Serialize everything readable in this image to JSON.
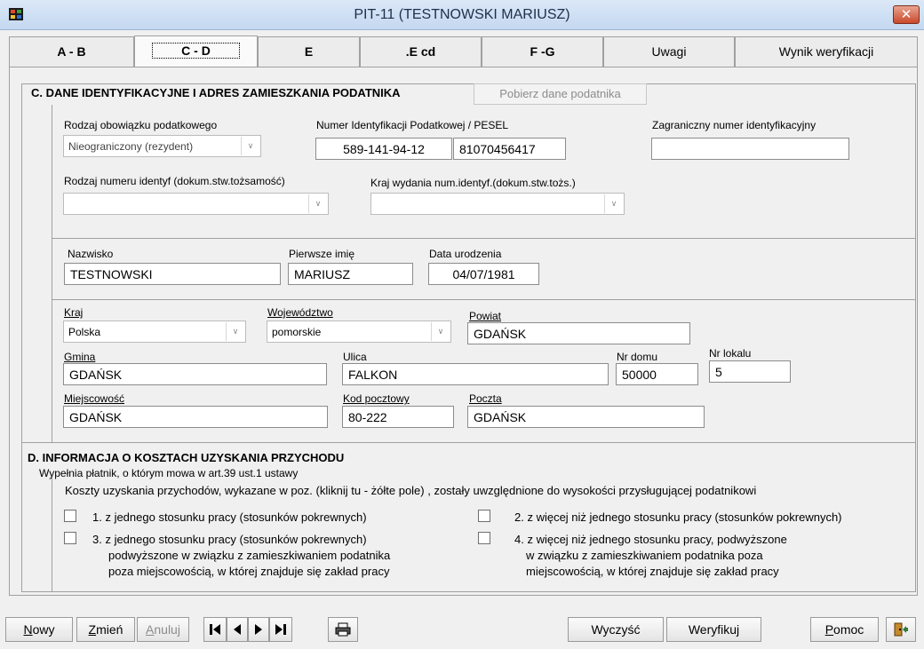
{
  "window": {
    "title": "PIT-11 (TESTNOWSKI MARIUSZ)",
    "close": "✕"
  },
  "tabs": [
    {
      "label": "A - B"
    },
    {
      "label": "C - D"
    },
    {
      "label": "E"
    },
    {
      "label": ".E cd"
    },
    {
      "label": "F -G"
    },
    {
      "label": "Uwagi"
    },
    {
      "label": "Wynik weryfikacji"
    }
  ],
  "sectionC": {
    "title": "C. DANE IDENTYFIKACYJNE I ADRES ZAMIESZKANIA  PODATNIKA",
    "fetch_button": "Pobierz dane podatnika",
    "tax_obligation_label": "Rodzaj obowiązku podatkowego",
    "tax_obligation_value": "Nieograniczony (rezydent)",
    "nip_label": "Numer Identyfikacji Podatkowej / PESEL",
    "nip_value": "589-141-94-12",
    "pesel_value": "81070456417",
    "foreign_id_label": "Zagraniczny numer identyfikacyjny",
    "foreign_id_value": "",
    "id_type_label": "Rodzaj numeru identyf (dokum.stw.tożsamość)",
    "id_type_value": "",
    "id_country_label": "Kraj wydania num.identyf.(dokum.stw.tożs.)",
    "id_country_value": "",
    "surname_label": "Nazwisko",
    "surname_value": "TESTNOWSKI",
    "firstname_label": "Pierwsze imię",
    "firstname_value": "MARIUSZ",
    "birthdate_label": "Data urodzenia",
    "birthdate_value": "04/07/1981",
    "country_label": "Kraj",
    "country_value": "Polska",
    "voivodeship_label": "Województwo",
    "voivodeship_value": "pomorskie",
    "county_label": "Powiat",
    "county_value": "GDAŃSK",
    "commune_label": "Gmina",
    "commune_value": "GDAŃSK",
    "street_label": "Ulica",
    "street_value": "FALKON",
    "house_label": "Nr domu",
    "house_value": "50000",
    "apt_label": "Nr lokalu",
    "apt_value": "5",
    "city_label": "Miejscowość",
    "city_value": "GDAŃSK",
    "postcode_label": "Kod pocztowy",
    "postcode_value": "80-222",
    "post_label": "Poczta",
    "post_value": "GDAŃSK"
  },
  "sectionD": {
    "title": "D. INFORMACJA O KOSZTACH UZYSKANIA PRZYCHODU",
    "subtitle": "Wypełnia płatnik, o którym mowa w art.39 ust.1 ustawy",
    "desc": "Koszty uzyskania przychodów, wykazane w poz. (kliknij tu - żółte pole) , zostały uwzględnione do wysokości przysługującej podatnikowi",
    "opt1": "1. z jednego stosunku pracy (stosunków pokrewnych)",
    "opt2": "2. z więcej niż jednego stosunku pracy (stosunków pokrewnych)",
    "opt3_l1": "3. z jednego stosunku pracy (stosunków pokrewnych)",
    "opt3_l2": "podwyższone w związku z zamieszkiwaniem podatnika",
    "opt3_l3": "poza miejscowością, w której znajduje się zakład pracy",
    "opt4_l1": "4. z więcej niż jednego stosunku pracy, podwyższone",
    "opt4_l2": "w związku z zamieszkiwaniem podatnika poza",
    "opt4_l3": "miejscowością, w której znajduje się zakład pracy"
  },
  "toolbar": {
    "new": {
      "u": "N",
      "rest": "owy"
    },
    "change": {
      "u": "Z",
      "rest": "mień"
    },
    "cancel": {
      "u": "A",
      "rest": "nuluj"
    },
    "clear": "Wyczyść",
    "verify": "Weryfikuj",
    "help": {
      "u": "P",
      "rest": "omoc"
    }
  }
}
